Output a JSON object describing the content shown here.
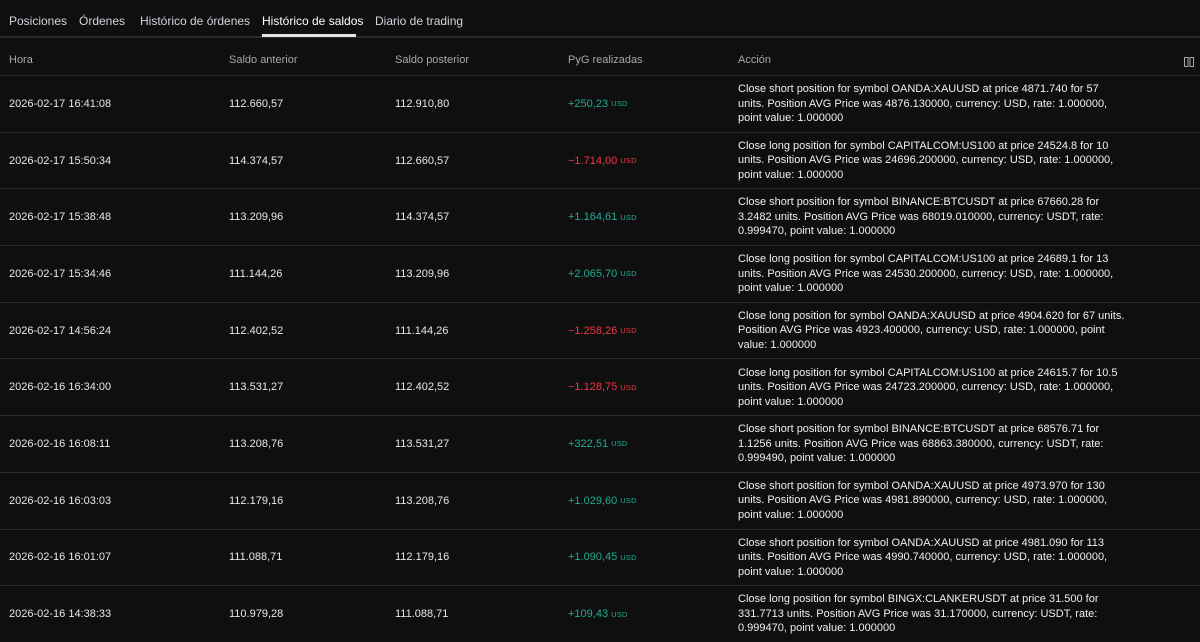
{
  "tabs": [
    {
      "label": "Posiciones",
      "active": false
    },
    {
      "label": "Órdenes",
      "active": false
    },
    {
      "label": "Histórico de órdenes",
      "active": false
    },
    {
      "label": "Histórico de saldos",
      "active": true
    },
    {
      "label": "Diario de trading",
      "active": false
    }
  ],
  "columns": {
    "hora": "Hora",
    "saldo_anterior": "Saldo anterior",
    "saldo_posterior": "Saldo posterior",
    "pyg": "PyG realizadas",
    "accion": "Acción"
  },
  "colors": {
    "positive": "#22ab94",
    "negative": "#f23645"
  },
  "rows": [
    {
      "hora": "2026-02-17 16:41:08",
      "ant": "112.660,57",
      "post": "112.910,80",
      "pyg": "+250,23",
      "cur": "USD",
      "sign": "pos",
      "accion": "Close short position for symbol OANDA:XAUUSD at price 4871.740 for 57 units. Position AVG Price was 4876.130000, currency: USD, rate: 1.000000, point value: 1.000000"
    },
    {
      "hora": "2026-02-17 15:50:34",
      "ant": "114.374,57",
      "post": "112.660,57",
      "pyg": "−1.714,00",
      "cur": "USD",
      "sign": "neg",
      "accion": "Close long position for symbol CAPITALCOM:US100 at price 24524.8 for 10 units. Position AVG Price was 24696.200000, currency: USD, rate: 1.000000, point value: 1.000000"
    },
    {
      "hora": "2026-02-17 15:38:48",
      "ant": "113.209,96",
      "post": "114.374,57",
      "pyg": "+1.164,61",
      "cur": "USD",
      "sign": "pos",
      "accion": "Close short position for symbol BINANCE:BTCUSDT at price 67660.28 for 3.2482 units. Position AVG Price was 68019.010000, currency: USDT, rate: 0.999470, point value: 1.000000"
    },
    {
      "hora": "2026-02-17 15:34:46",
      "ant": "111.144,26",
      "post": "113.209,96",
      "pyg": "+2.065,70",
      "cur": "USD",
      "sign": "pos",
      "accion": "Close long position for symbol CAPITALCOM:US100 at price 24689.1 for 13 units. Position AVG Price was 24530.200000, currency: USD, rate: 1.000000, point value: 1.000000"
    },
    {
      "hora": "2026-02-17 14:56:24",
      "ant": "112.402,52",
      "post": "111.144,26",
      "pyg": "−1.258,26",
      "cur": "USD",
      "sign": "neg",
      "accion": "Close long position for symbol OANDA:XAUUSD at price 4904.620 for 67 units. Position AVG Price was 4923.400000, currency: USD, rate: 1.000000, point value: 1.000000"
    },
    {
      "hora": "2026-02-16 16:34:00",
      "ant": "113.531,27",
      "post": "112.402,52",
      "pyg": "−1.128,75",
      "cur": "USD",
      "sign": "neg",
      "accion": "Close long position for symbol CAPITALCOM:US100 at price 24615.7 for 10.5 units. Position AVG Price was 24723.200000, currency: USD, rate: 1.000000, point value: 1.000000"
    },
    {
      "hora": "2026-02-16 16:08:11",
      "ant": "113.208,76",
      "post": "113.531,27",
      "pyg": "+322,51",
      "cur": "USD",
      "sign": "pos",
      "accion": "Close short position for symbol BINANCE:BTCUSDT at price 68576.71 for 1.1256 units. Position AVG Price was 68863.380000, currency: USDT, rate: 0.999490, point value: 1.000000"
    },
    {
      "hora": "2026-02-16 16:03:03",
      "ant": "112.179,16",
      "post": "113.208,76",
      "pyg": "+1.029,60",
      "cur": "USD",
      "sign": "pos",
      "accion": "Close short position for symbol OANDA:XAUUSD at price 4973.970 for 130 units. Position AVG Price was 4981.890000, currency: USD, rate: 1.000000, point value: 1.000000"
    },
    {
      "hora": "2026-02-16 16:01:07",
      "ant": "111.088,71",
      "post": "112.179,16",
      "pyg": "+1.090,45",
      "cur": "USD",
      "sign": "pos",
      "accion": "Close short position for symbol OANDA:XAUUSD at price 4981.090 for 113 units. Position AVG Price was 4990.740000, currency: USD, rate: 1.000000, point value: 1.000000"
    },
    {
      "hora": "2026-02-16 14:38:33",
      "ant": "110.979,28",
      "post": "111.088,71",
      "pyg": "+109,43",
      "cur": "USD",
      "sign": "pos",
      "accion": "Close long position for symbol BINGX:CLANKERUSDT at price 31.500 for 331.7713 units. Position AVG Price was 31.170000, currency: USDT, rate: 0.999470, point value: 1.000000"
    }
  ]
}
